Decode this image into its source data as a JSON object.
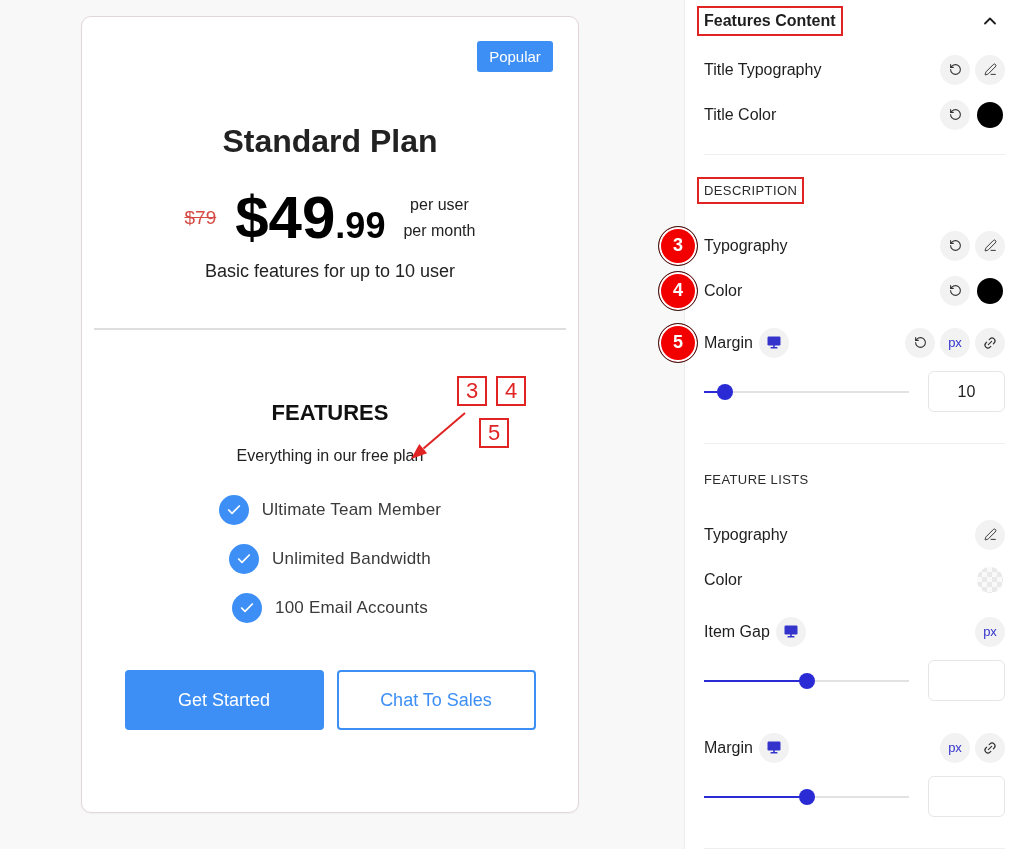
{
  "preview_card": {
    "badge": "Popular",
    "title": "Standard Plan",
    "old_price": "$79",
    "price": {
      "whole": "$49",
      "fraction": ".99"
    },
    "billing_period": [
      "per user",
      "per month"
    ],
    "subtitle": "Basic features for up to 10 user",
    "features_heading": "FEATURES",
    "features_description": "Everything in our free plan",
    "callouts": [
      "3",
      "4",
      "5"
    ],
    "features": [
      "Ultimate Team Member",
      "Unlimited Bandwidth",
      "100 Email Accounts"
    ],
    "buttons": [
      {
        "label": "Get Started",
        "kind": "primary"
      },
      {
        "label": "Chat To Sales",
        "kind": "outline"
      }
    ]
  },
  "settings_panel": {
    "title": "Features Content",
    "expanded": true,
    "highlighted": true,
    "sections": [
      {
        "rows": [
          {
            "label": "Title Typography",
            "responsive": false,
            "controls": [
              {
                "kind": "reset"
              },
              {
                "kind": "edit"
              }
            ]
          },
          {
            "label": "Title Color",
            "responsive": false,
            "controls": [
              {
                "kind": "reset"
              },
              {
                "kind": "swatch",
                "color": "#000000"
              }
            ]
          }
        ]
      },
      {
        "heading": "DESCRIPTION",
        "highlighted": true,
        "rows": [
          {
            "label": "Typography",
            "marker": "3",
            "responsive": false,
            "controls": [
              {
                "kind": "reset"
              },
              {
                "kind": "edit"
              }
            ]
          },
          {
            "label": "Color",
            "marker": "4",
            "responsive": false,
            "controls": [
              {
                "kind": "reset"
              },
              {
                "kind": "swatch",
                "color": "#000000"
              }
            ]
          },
          {
            "label": "Margin",
            "marker": "5",
            "responsive": true,
            "controls": [
              {
                "kind": "reset"
              },
              {
                "kind": "unit",
                "label": "px"
              },
              {
                "kind": "link"
              }
            ],
            "slider": {
              "level": 0.1,
              "value": "10"
            }
          }
        ]
      },
      {
        "heading": "FEATURE LISTS",
        "highlighted": false,
        "rows": [
          {
            "label": "Typography",
            "responsive": false,
            "controls": [
              {
                "kind": "edit"
              }
            ]
          },
          {
            "label": "Color",
            "responsive": false,
            "controls": [
              {
                "kind": "empty_swatch"
              }
            ]
          },
          {
            "label": "Item Gap",
            "responsive": true,
            "controls": [
              {
                "kind": "unit",
                "label": "px"
              }
            ],
            "slider": {
              "level": 0.5
            }
          },
          {
            "label": "Margin",
            "responsive": true,
            "controls": [
              {
                "kind": "unit",
                "label": "px"
              },
              {
                "kind": "link"
              }
            ],
            "slider": {
              "level": 0.5
            }
          }
        ]
      }
    ]
  }
}
